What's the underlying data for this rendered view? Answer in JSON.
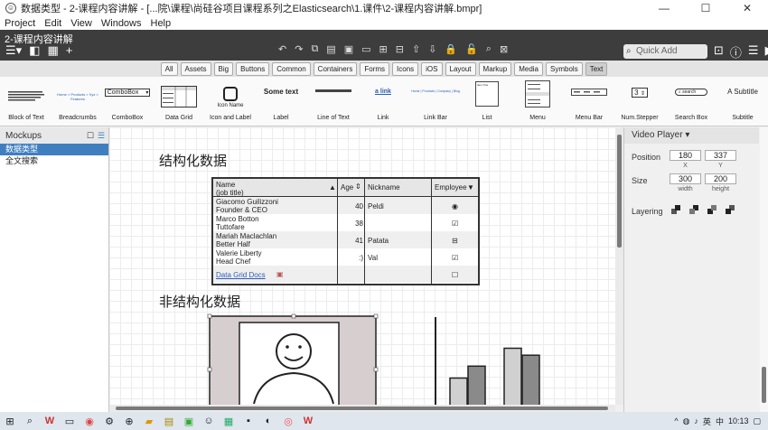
{
  "window": {
    "title": "数据类型 - 2-课程内容讲解 - [...院\\课程\\尚硅谷项目课程系列之Elasticsearch\\1.课件\\2-课程内容讲解.bmpr]",
    "minimize": "—",
    "maximize": "☐",
    "close": "✕"
  },
  "menu": [
    "Project",
    "Edit",
    "View",
    "Windows",
    "Help"
  ],
  "doc_title": "2-课程内容讲解",
  "quick_add": {
    "placeholder": "Quick Add"
  },
  "filters": [
    "All",
    "Assets",
    "Big",
    "Buttons",
    "Common",
    "Containers",
    "Forms",
    "Icons",
    "iOS",
    "Layout",
    "Markup",
    "Media",
    "Symbols",
    "Text"
  ],
  "active_filter": "Text",
  "gallery": [
    {
      "label": "Block of Text"
    },
    {
      "label": "Breadcrumbs",
      "sample": "Home > Products > Xyz > Features"
    },
    {
      "label": "ComboBox",
      "sample": "ComboBox"
    },
    {
      "label": "Data Grid"
    },
    {
      "label": "Icon and Label",
      "sample": "Icon Name"
    },
    {
      "label": "Label",
      "sample": "Some text"
    },
    {
      "label": "Line of Text"
    },
    {
      "label": "Link",
      "sample": "a link"
    },
    {
      "label": "Link Bar",
      "sample": "Home | Products | Company | Blog"
    },
    {
      "label": "List",
      "sample": "Item One"
    },
    {
      "label": "Menu"
    },
    {
      "label": "Menu Bar"
    },
    {
      "label": "Num.Stepper",
      "sample": "3"
    },
    {
      "label": "Search Box",
      "sample": "search"
    },
    {
      "label": "Subtitle",
      "sample": "A Subtitle"
    }
  ],
  "left_panel": {
    "title": "Mockups",
    "items": [
      "数据类型",
      "全文搜索"
    ],
    "selected": 0
  },
  "canvas": {
    "heading1": "结构化数据",
    "heading2": "非结构化数据",
    "grid": {
      "headers": [
        "Name\n(job title)",
        "Age",
        "Nickname",
        "Employee"
      ],
      "rows": [
        {
          "name": "Giacomo Guilizzoni\nFounder & CEO",
          "age": "40",
          "nickname": "Peldi",
          "employee": "radio"
        },
        {
          "name": "Marco Botton\nTuttofare",
          "age": "38",
          "nickname": "",
          "employee": "checked"
        },
        {
          "name": "Mariah Maclachlan\nBetter Half",
          "age": "41",
          "nickname": "Patata",
          "employee": "indeterminate"
        },
        {
          "name": "Valerie Liberty\nHead Chef",
          "age": ":)",
          "nickname": "Val",
          "employee": "checked"
        },
        {
          "name": "Data Grid Docs",
          "age": "",
          "nickname": "",
          "employee": "unchecked",
          "link": true
        }
      ]
    },
    "bar_chart": {
      "values": [
        0.35,
        0.47,
        0.65,
        0.58
      ]
    }
  },
  "inspector": {
    "title": "Video Player",
    "position_label": "Position",
    "x": "180",
    "y": "337",
    "x_label": "X",
    "y_label": "Y",
    "size_label": "Size",
    "width": "300",
    "height": "200",
    "width_label": "width",
    "height_label": "height",
    "layering_label": "Layering"
  },
  "taskbar": {
    "time": "10:13",
    "ime": "英",
    "ime2": "中"
  }
}
